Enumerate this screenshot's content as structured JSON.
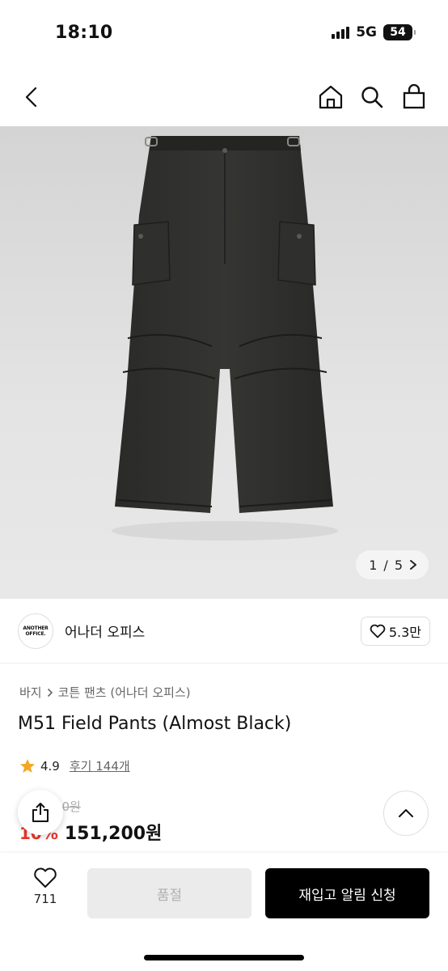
{
  "status_bar": {
    "time": "18:10",
    "network": "5G",
    "battery": "54"
  },
  "nav": {
    "back_icon": "chevron-left-icon",
    "home_icon": "home-icon",
    "search_icon": "search-icon",
    "cart_icon": "shopping-bag-icon"
  },
  "gallery": {
    "current": "1",
    "separator": "/",
    "total": "5"
  },
  "brand": {
    "logo_line1": "ANOTHER",
    "logo_line2": "OFFICE.",
    "name": "어나더 오피스",
    "likes": "5.3만"
  },
  "product": {
    "breadcrumb": [
      "바지",
      "코튼 팬츠 (어나더 오피스)"
    ],
    "title": "M51 Field Pants (Almost Black)",
    "rating": "4.9",
    "reviews": "후기 144개",
    "original_price": "168,000원",
    "discount": "10%",
    "price": "151,200원"
  },
  "bottom_bar": {
    "wish_count": "711",
    "soldout_label": "품절",
    "restock_label": "재입고 알림 신청"
  },
  "colors": {
    "accent_discount": "#e8352b",
    "star": "#f5a623",
    "primary_button": "#000000",
    "disabled_button": "#ebebeb"
  }
}
